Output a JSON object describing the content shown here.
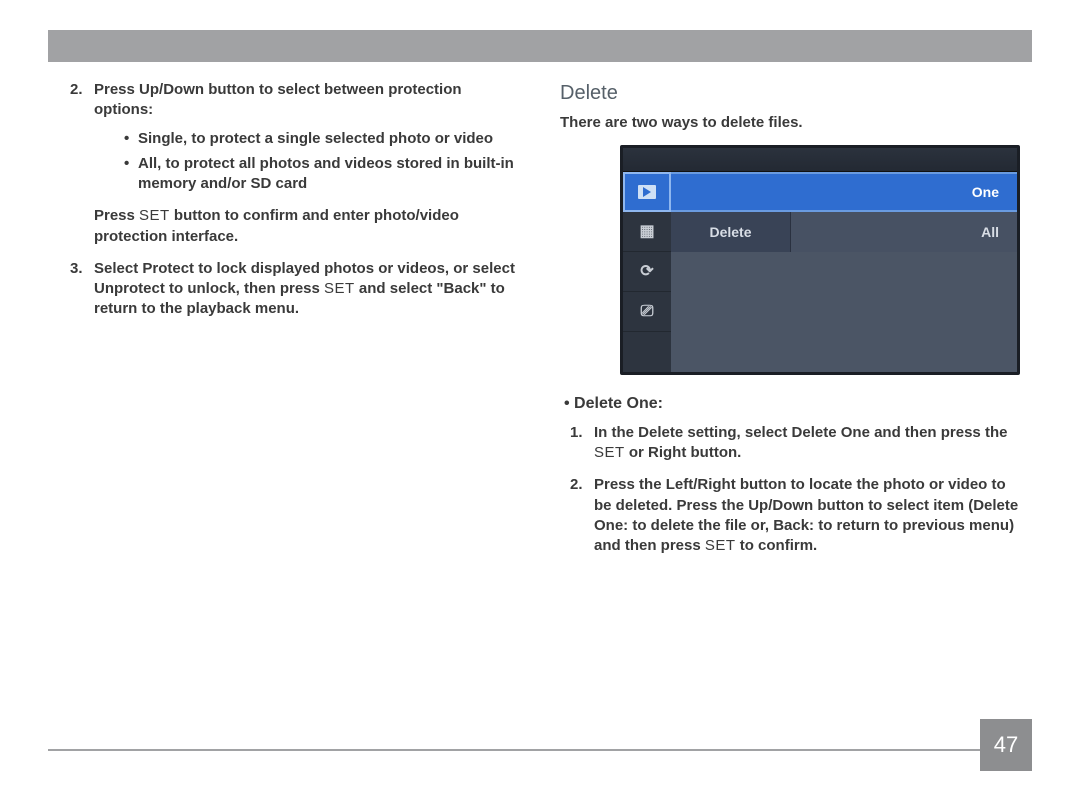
{
  "page_number": "47",
  "left_column": {
    "step2_text": "Press Up/Down button to select between protection options:",
    "bullets": [
      "Single, to protect a single selected photo or video",
      "All, to protect all photos and videos stored in built-in memory and/or SD card"
    ],
    "press_set_prefix": "Press ",
    "set_label_1": "SET",
    "press_set_suffix": " button to confirm and enter photo/video protection interface.",
    "step3_prefix": "Select Protect to lock displayed photos or videos, or select Unprotect to unlock, then press ",
    "set_label_2": "SET",
    "step3_suffix": " and select \"Back\" to return to the playback menu."
  },
  "right_column": {
    "title": "Delete",
    "intro": "There are two ways to delete files.",
    "screen": {
      "menu_row_one": "One",
      "menu_row_delete": "Delete",
      "menu_row_all": "All",
      "sidebar_icons": [
        "play-icon",
        "texture-icon",
        "refresh-icon",
        "usb-icon"
      ]
    },
    "subhead": "• Delete One:",
    "step1_prefix": "In the Delete setting, select Delete One and then press the ",
    "set_label_3": "SET",
    "step1_suffix": " or Right button.",
    "step2_prefix": "Press the Left/Right button to locate the photo or video to be deleted. Press the Up/Down button to select item (Delete One: to delete the file or, Back: to return to previous menu) and then press ",
    "set_label_4": "SET",
    "step2_suffix": " to confirm."
  }
}
